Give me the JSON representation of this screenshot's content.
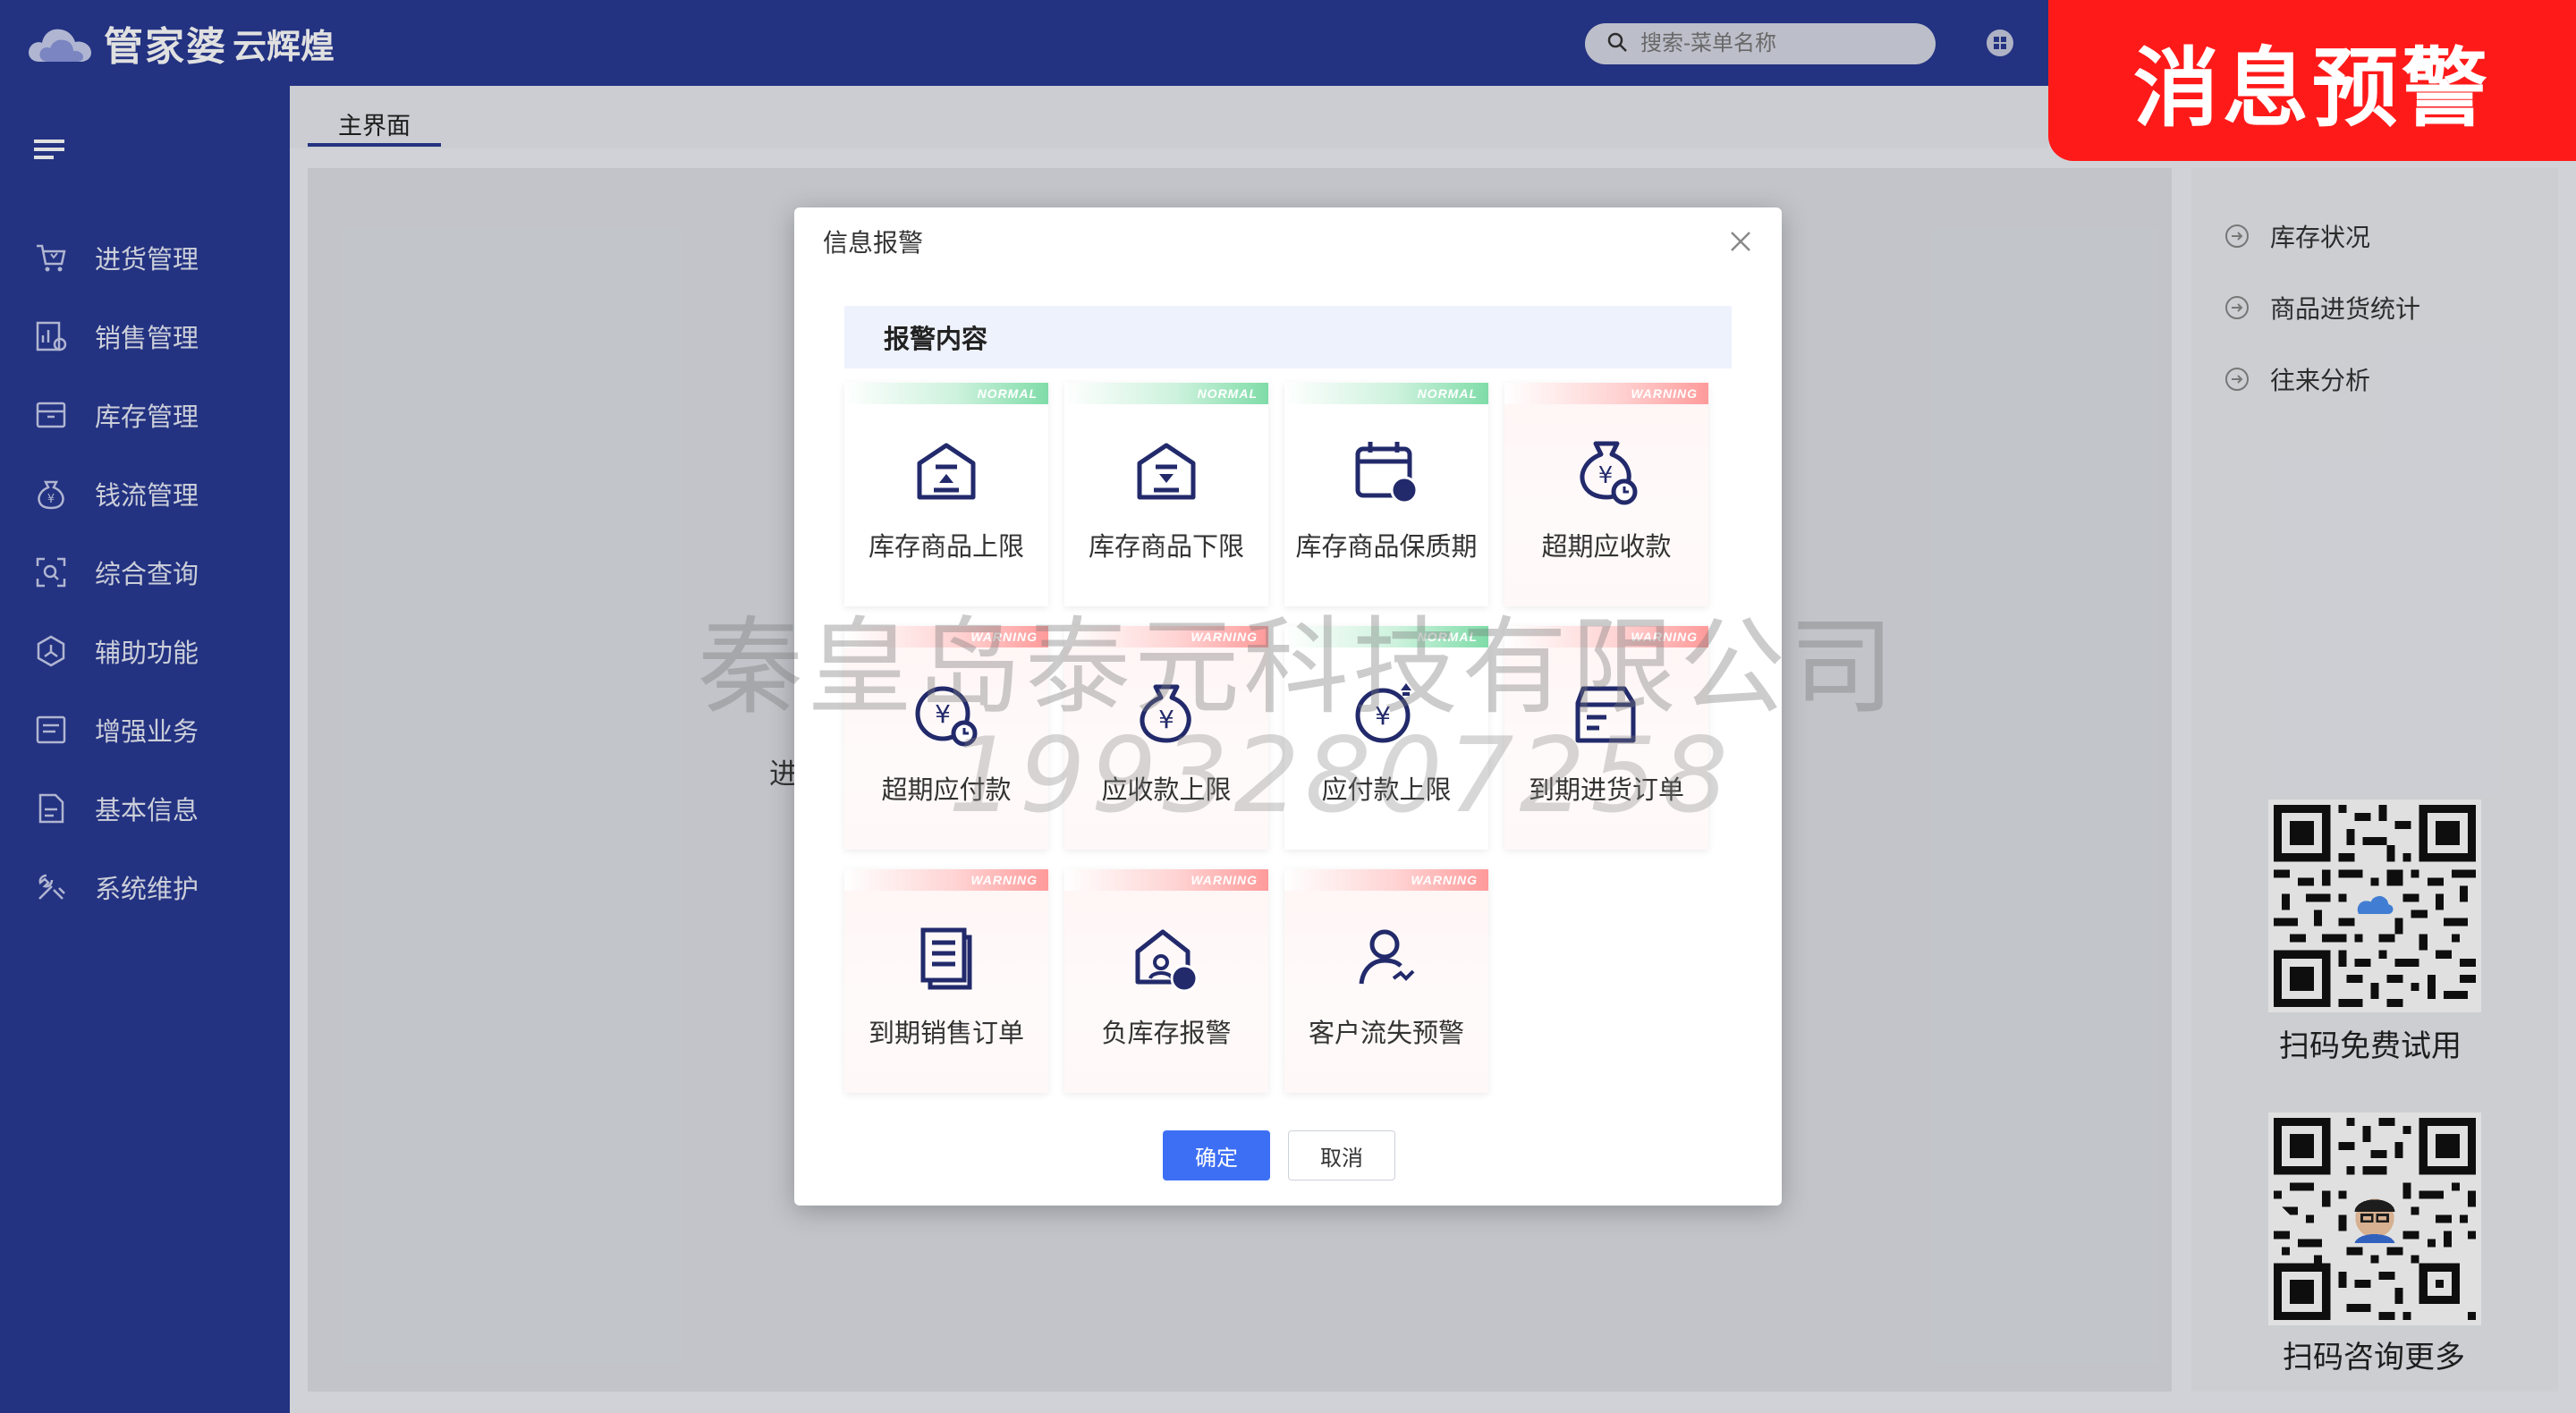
{
  "header": {
    "brand_main": "管家婆",
    "brand_sub": "云辉煌",
    "search_placeholder": "搜索-菜单名称"
  },
  "promo": {
    "banner_text": "消息预警"
  },
  "sidebar": {
    "items": [
      {
        "label": "进货管理",
        "icon": "cart-icon"
      },
      {
        "label": "销售管理",
        "icon": "sales-chart-icon"
      },
      {
        "label": "库存管理",
        "icon": "inventory-box-icon"
      },
      {
        "label": "钱流管理",
        "icon": "money-bag-icon"
      },
      {
        "label": "综合查询",
        "icon": "query-scan-icon"
      },
      {
        "label": "辅助功能",
        "icon": "hexagon-icon"
      },
      {
        "label": "增强业务",
        "icon": "list-doc-icon"
      },
      {
        "label": "基本信息",
        "icon": "document-icon"
      },
      {
        "label": "系统维护",
        "icon": "tools-icon"
      }
    ]
  },
  "tabs": {
    "main_tab": "主界面"
  },
  "right_panel": {
    "links": [
      "库存状况",
      "商品进货统计",
      "往来分析"
    ],
    "qr1_label": "扫码免费试用",
    "qr2_label": "扫码咨询更多"
  },
  "background_text": "进",
  "modal": {
    "title": "信息报警",
    "section_title": "报警内容",
    "cards": [
      {
        "label": "库存商品上限",
        "status": "NORMAL",
        "icon": "warehouse-up-icon"
      },
      {
        "label": "库存商品下限",
        "status": "NORMAL",
        "icon": "warehouse-down-icon"
      },
      {
        "label": "库存商品保质期",
        "status": "NORMAL",
        "icon": "calendar-clock-icon"
      },
      {
        "label": "超期应收款",
        "status": "WARNING",
        "icon": "money-bag-clock-icon"
      },
      {
        "label": "超期应付款",
        "status": "WARNING",
        "icon": "coin-clock-icon"
      },
      {
        "label": "应收款上限",
        "status": "WARNING",
        "icon": "money-bag-icon"
      },
      {
        "label": "应付款上限",
        "status": "NORMAL",
        "icon": "coin-up-icon"
      },
      {
        "label": "到期进货订单",
        "status": "WARNING",
        "icon": "purchase-box-icon"
      },
      {
        "label": "到期销售订单",
        "status": "WARNING",
        "icon": "sales-doc-icon"
      },
      {
        "label": "负库存报警",
        "status": "WARNING",
        "icon": "negative-stock-icon"
      },
      {
        "label": "客户流失预警",
        "status": "WARNING",
        "icon": "customer-loss-icon"
      }
    ],
    "ok_label": "确定",
    "cancel_label": "取消"
  },
  "watermark": {
    "company": "秦皇岛泰元科技有限公司",
    "phone": "19932807258"
  },
  "colors": {
    "primary": "#283a93",
    "accent_button": "#3d6ff5",
    "normal_ribbon": "#7fdca8",
    "warning_ribbon": "#ff9a9a",
    "promo_red": "#ff1a1a"
  }
}
